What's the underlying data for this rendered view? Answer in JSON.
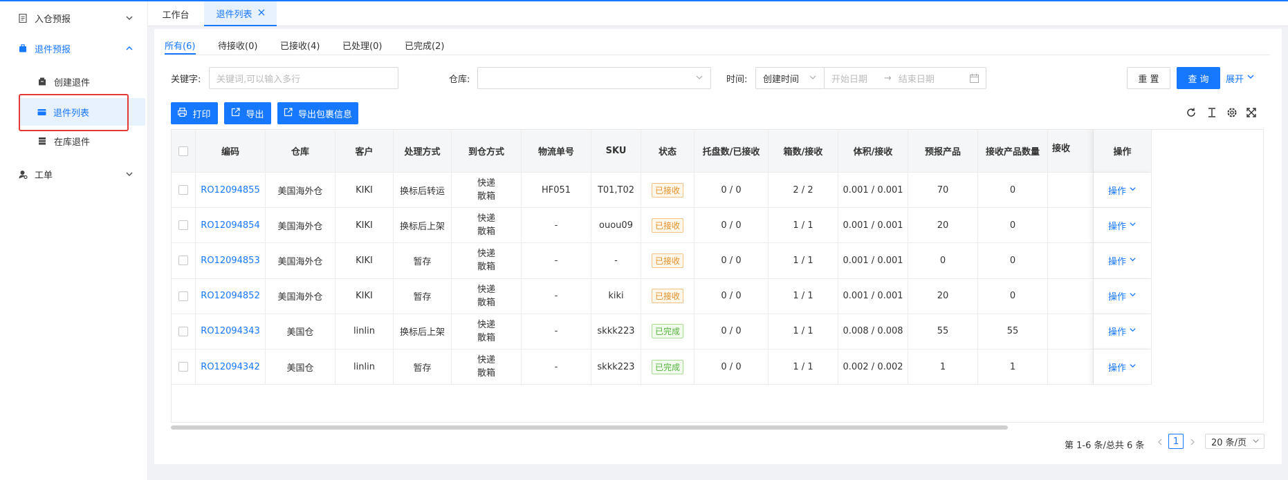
{
  "sidebar": {
    "items": [
      {
        "label": "入仓预报",
        "icon": "document-icon"
      },
      {
        "label": "退件预报",
        "icon": "bag-icon"
      },
      {
        "label": "创建退件",
        "icon": "create-icon"
      },
      {
        "label": "退件列表",
        "icon": "list-icon"
      },
      {
        "label": "在库退件",
        "icon": "stock-icon"
      },
      {
        "label": "工单",
        "icon": "user-icon"
      }
    ]
  },
  "tabs": [
    {
      "label": "工作台"
    },
    {
      "label": "退件列表"
    }
  ],
  "status_tabs": [
    {
      "label": "所有(6)"
    },
    {
      "label": "待接收(0)"
    },
    {
      "label": "已接收(4)"
    },
    {
      "label": "已处理(0)"
    },
    {
      "label": "已完成(2)"
    }
  ],
  "filters": {
    "keyword_label": "关键字:",
    "keyword_placeholder": "关键词,可以输入多行",
    "warehouse_label": "仓库:",
    "time_label": "时间:",
    "time_type": "创建时间",
    "start_placeholder": "开始日期",
    "arrow": "→",
    "end_placeholder": "结束日期",
    "reset_label": "重 置",
    "query_label": "查 询",
    "expand_label": "展开"
  },
  "actions": {
    "print_label": "打印",
    "export_label": "导出",
    "export_pkg_label": "导出包裹信息"
  },
  "table": {
    "columns": [
      "编码",
      "仓库",
      "客户",
      "处理方式",
      "到仓方式",
      "物流单号",
      "SKU",
      "状态",
      "托盘数/已接收",
      "箱数/接收",
      "体积/接收",
      "预报产品",
      "接收产品数量",
      "接收",
      "操作"
    ],
    "rows": [
      {
        "code": "RO12094855",
        "warehouse": "美国海外仓",
        "customer": "KIKI",
        "method": "换标后转运",
        "arrival1": "快递",
        "arrival2": "散箱",
        "tracking": "HF051",
        "sku": "T01,T02",
        "status": "已接收",
        "status_kind": "received",
        "pallet": "0 / 0",
        "boxes": "2 / 2",
        "volume": "0.001 / 0.001",
        "forecast": "70",
        "received_qty": "0",
        "op": "操作"
      },
      {
        "code": "RO12094854",
        "warehouse": "美国海外仓",
        "customer": "KIKI",
        "method": "换标后上架",
        "arrival1": "快递",
        "arrival2": "散箱",
        "tracking": "-",
        "sku": "ouou09",
        "status": "已接收",
        "status_kind": "received",
        "pallet": "0 / 0",
        "boxes": "1 / 1",
        "volume": "0.001 / 0.001",
        "forecast": "20",
        "received_qty": "0",
        "op": "操作"
      },
      {
        "code": "RO12094853",
        "warehouse": "美国海外仓",
        "customer": "KIKI",
        "method": "暂存",
        "arrival1": "快递",
        "arrival2": "散箱",
        "tracking": "-",
        "sku": "-",
        "status": "已接收",
        "status_kind": "received",
        "pallet": "0 / 0",
        "boxes": "1 / 1",
        "volume": "0.001 / 0.001",
        "forecast": "0",
        "received_qty": "0",
        "op": "操作"
      },
      {
        "code": "RO12094852",
        "warehouse": "美国海外仓",
        "customer": "KIKI",
        "method": "暂存",
        "arrival1": "快递",
        "arrival2": "散箱",
        "tracking": "-",
        "sku": "kiki",
        "status": "已接收",
        "status_kind": "received",
        "pallet": "0 / 0",
        "boxes": "1 / 1",
        "volume": "0.001 / 0.001",
        "forecast": "20",
        "received_qty": "0",
        "op": "操作"
      },
      {
        "code": "RO12094343",
        "warehouse": "美国仓",
        "customer": "linlin",
        "method": "换标后上架",
        "arrival1": "快递",
        "arrival2": "散箱",
        "tracking": "-",
        "sku": "skkk223",
        "status": "已完成",
        "status_kind": "done",
        "pallet": "0 / 0",
        "boxes": "1 / 1",
        "volume": "0.008 / 0.008",
        "forecast": "55",
        "received_qty": "55",
        "op": "操作"
      },
      {
        "code": "RO12094342",
        "warehouse": "美国仓",
        "customer": "linlin",
        "method": "暂存",
        "arrival1": "快递",
        "arrival2": "散箱",
        "tracking": "-",
        "sku": "skkk223",
        "status": "已完成",
        "status_kind": "done",
        "pallet": "0 / 0",
        "boxes": "1 / 1",
        "volume": "0.002 / 0.002",
        "forecast": "1",
        "received_qty": "1",
        "op": "操作"
      }
    ]
  },
  "pagination": {
    "summary": "第 1-6 条/总共 6 条",
    "current_page": "1",
    "page_size": "20 条/页"
  },
  "colors": {
    "primary": "#1677ff",
    "received": "#e8912b",
    "done": "#52b43a",
    "highlight": "#e53935"
  }
}
